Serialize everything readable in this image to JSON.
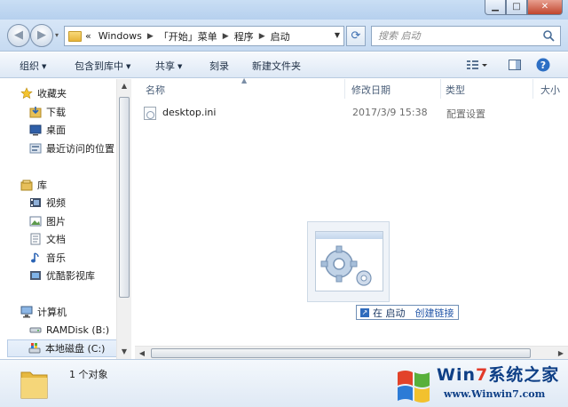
{
  "window": {
    "controls": {
      "minimize": "▁",
      "maximize": "□",
      "close": "✕"
    }
  },
  "nav": {
    "back": "◀",
    "forward": "▶",
    "recent": "▾",
    "address_overflow": "«",
    "breadcrumbs": [
      "Windows",
      "「开始」菜单",
      "程序",
      "启动"
    ],
    "search_placeholder": "搜索 启动"
  },
  "toolbar": {
    "organize": "组织",
    "include_in_library": "包含到库中",
    "share": "共享",
    "burn": "刻录",
    "new_folder": "新建文件夹"
  },
  "navpane": {
    "favorites": "收藏夹",
    "downloads": "下载",
    "desktop": "桌面",
    "recent_places": "最近访问的位置",
    "libraries": "库",
    "videos": "视频",
    "pictures": "图片",
    "documents": "文档",
    "music": "音乐",
    "youku": "优酷影视库",
    "computer": "计算机",
    "ramdisk": "RAMDisk (B:)",
    "local_disk": "本地磁盘 (C:)"
  },
  "columns": {
    "name": "名称",
    "date_modified": "修改日期",
    "type": "类型",
    "size": "大小"
  },
  "files": [
    {
      "name": "desktop.ini",
      "date": "2017/3/9 15:38",
      "type": "配置设置"
    }
  ],
  "drag": {
    "prep": "在 启动",
    "action": "创建链接"
  },
  "status": {
    "count": "1 个对象"
  },
  "watermark": {
    "title_a": "Win",
    "title_seven": "7",
    "title_b": "系统之家",
    "url": "www.Winwin7.com"
  },
  "colors": {
    "accent": "#2356a8",
    "frame": "#c6daf1",
    "watermark_blue": "#0e3f86",
    "watermark_red": "#e23a2a"
  }
}
